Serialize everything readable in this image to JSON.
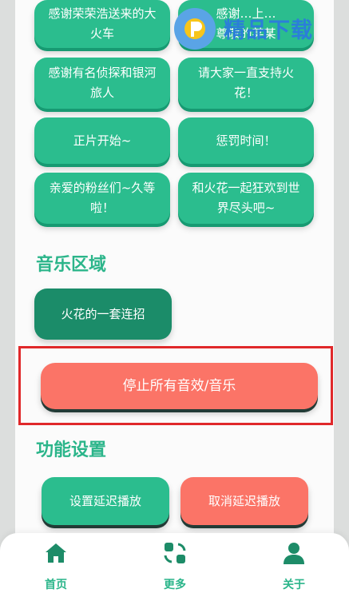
{
  "greetings": {
    "b1": "感谢荣荣浩送来的大火车",
    "b2_line1": "感谢…上…",
    "b2_line2": "尊敬的某某",
    "b3": "感谢有名侦探和银河旅人",
    "b4": "请大家一直支持火花！",
    "b5": "正片开始~",
    "b6": "惩罚时间！",
    "b7": "亲爱的粉丝们~久等啦！",
    "b8": "和火花一起狂欢到世界尽头吧~"
  },
  "music": {
    "title": "音乐区域",
    "combo_button": "火花的一套连招",
    "stop_button": "停止所有音效/音乐"
  },
  "settings": {
    "title": "功能设置",
    "set_delay_button": "设置延迟播放",
    "cancel_delay_button": "取消延迟播放"
  },
  "tabbar": {
    "home": {
      "label": "首页",
      "icon": "home-icon"
    },
    "more": {
      "label": "更多",
      "icon": "more-icon"
    },
    "about": {
      "label": "关于",
      "icon": "user-icon"
    }
  },
  "watermark": {
    "text": "精品下载"
  },
  "colors": {
    "primary": "#2bbd8e",
    "primary_dark": "#1b8c69",
    "danger": "#fb7467",
    "highlight_border": "#e0282a"
  }
}
